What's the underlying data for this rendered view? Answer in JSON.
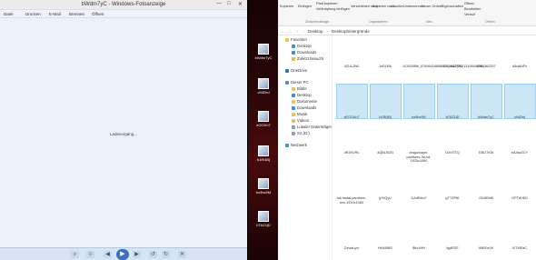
{
  "viewer": {
    "title": "bWdm7yC - Windows-Fotoanzeige",
    "window_controls": [
      "—",
      "□",
      "✕"
    ],
    "menu": [
      "Datei",
      "Drucken",
      "E-Mail",
      "Brennen",
      "Öffnen"
    ],
    "loading_text": "Ladevorgang...",
    "toolbar": {
      "buttons": [
        "zoom-icon",
        "fit-icon",
        "prev-icon",
        "play-icon",
        "next-icon",
        "rotate-left-icon",
        "rotate-right-icon",
        "delete-icon"
      ]
    },
    "accent": "#3b71b8"
  },
  "desktop": {
    "icons": [
      "bWdm7yC",
      "c9IiZhd",
      "eOOXn7",
      "b1Rl4Bj",
      "bx9hc9M",
      "bTAZ1jD"
    ]
  },
  "explorer": {
    "ribbon": {
      "copy": "Kopieren",
      "paste": "Einfügen",
      "cut": "Pfad kopieren",
      "paste_shortcut": "Verknüpfung einfügen",
      "group_clipboard": "Zwischenablage",
      "move_to": "Verschieben nach",
      "copy_to": "Kopieren nach",
      "delete": "Löschen",
      "rename": "Umbenennen",
      "group_organize": "Organisieren",
      "new_folder": "Neuer Ordner",
      "group_new": "Neu",
      "properties": "Eigenschaften",
      "open": "Öffnen",
      "edit": "Bearbeiten",
      "history": "Verlauf",
      "group_open": "Öffnen"
    },
    "address": {
      "crumbs": [
        "Desktop",
        "Desktophintergründe"
      ]
    },
    "nav": {
      "favorites": "Favoriten",
      "fav_items": [
        "Desktop",
        "Downloads",
        "Zuletzt besucht"
      ],
      "onedrive": "OneDrive",
      "pc": "Dieser PC",
      "pc_items": [
        "Bilder",
        "Desktop",
        "Dokumente",
        "Downloads",
        "Musik",
        "Videos",
        "Lokaler Datenträger",
        "SA (D:)"
      ],
      "network": "Netzwerk"
    },
    "rows": [
      [
        "lIZULZtW",
        "1d01f06",
        "1015338fd_67698416858857_8112j2521319654098_",
        "1081d40750",
        "1384362257",
        "A8qNAFs"
      ],
      [
        "aFOOXn7",
        "b1Rl4Bj",
        "bx9hc9M",
        "bTAZ1jD",
        "bWdm7yC",
        "c9IiZhd"
      ],
      [
        "dRJNVRv",
        "dQBLRZN",
        "dragonlayer-panthers-3d-hd-1920x1080",
        "DXb7iTQ",
        "EBO7K5t",
        "eA4twZCY"
      ],
      [
        "full-metal-panthers-wm-1920x1080",
        "gYvQyU",
        "GAdEfeo7",
        "gTTZPtK",
        "GN3R6t8",
        "GPTdH5O"
      ],
      [
        "GzwaLym",
        "HH4B5fG",
        "iBrk4HH",
        "ilgdRZE",
        "IMKEuVK",
        "iXTMEaC"
      ]
    ],
    "selected_row": 1,
    "selection_color": "#cce6f8"
  }
}
